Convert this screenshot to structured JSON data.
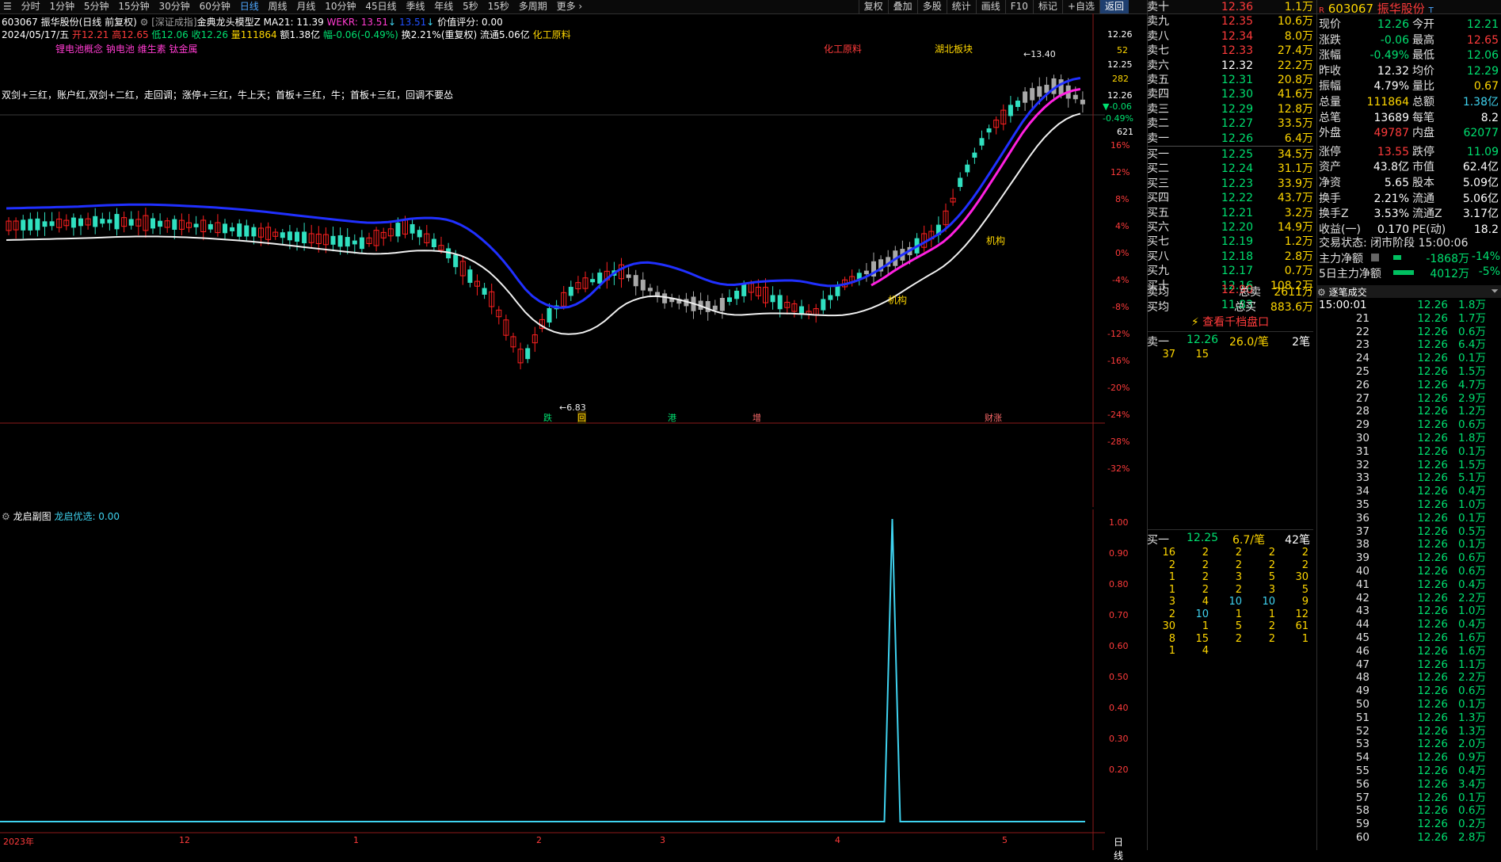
{
  "topbar": {
    "periods": [
      "分时",
      "1分钟",
      "5分钟",
      "15分钟",
      "30分钟",
      "60分钟",
      "日线",
      "周线",
      "月线",
      "10分钟",
      "45日线",
      "季线",
      "年线",
      "5秒",
      "15秒",
      "多周期",
      "更多"
    ],
    "active": "日线",
    "tools": [
      "复权",
      "叠加",
      "多股",
      "统计",
      "画线",
      "F10",
      "标记",
      "+自选",
      "返回"
    ]
  },
  "header": {
    "line1": {
      "code_name": "603067 振华股份(日线 前复权)",
      "index_source": "[深证成指]",
      "model": "金典龙头模型Z",
      "ma": "MA21: 11.39",
      "wekr": "WEKR: 13.51",
      "wekr2": "13.51",
      "value_score": "价值评分: 0.00"
    },
    "line2": {
      "date": "2024/05/17/五",
      "open": "开12.21",
      "high": "高12.65",
      "low": "低12.06",
      "close": "收12.26",
      "volume": "量111864",
      "amount": "额1.38亿",
      "change": "幅-0.06(-0.49%)",
      "turnover": "换2.21%(重复权)",
      "float": "流通5.06亿",
      "industry": "化工原料"
    },
    "concepts": "锂电池概念 钠电池 维生素 钛金属",
    "strategy_note": "双剑+三红，账户红,双剑+二红，走回调；涨停+三红，牛上天；首板+三红，牛；首板+三红，回调不要怂"
  },
  "chart_labels": {
    "sector1": "化工原料",
    "sector2": "湖北板块",
    "high_mark": "13.40",
    "low_mark": "6.83",
    "inst1": "机构",
    "inst2": "机构",
    "events": [
      "跌",
      "回",
      "港",
      "增",
      "财涨"
    ],
    "x_labels": [
      "2023年",
      "12",
      "1",
      "2",
      "3",
      "4",
      "5"
    ],
    "period_tag": "日线"
  },
  "right_axis": {
    "price_top": "12.26",
    "vals": [
      "12.26",
      "52",
      "12.25",
      "282",
      "12.26",
      "▼-0.06",
      "-0.49%",
      "621"
    ],
    "pct": [
      "16%",
      "12%",
      "8%",
      "4%",
      "0%",
      "-4%",
      "-8%",
      "-12%",
      "-16%",
      "-20%",
      "-24%",
      "-28%",
      "-32%"
    ],
    "sub": [
      "1.00",
      "0.90",
      "0.80",
      "0.70",
      "0.60",
      "0.50",
      "0.40",
      "0.30",
      "0.20"
    ]
  },
  "subchart": {
    "title": "龙启副图",
    "indicator": "龙启优选: 0.00"
  },
  "chart_data": {
    "type": "line",
    "title": "龙启优选",
    "x": [
      "2023-11",
      "2023-12",
      "2024-01",
      "2024-02",
      "2024-03",
      "2024-04",
      "2024-05"
    ],
    "series": [
      {
        "name": "龙启优选",
        "signal_index_fraction": 0.815,
        "peak": 1.0,
        "baseline": 0.0
      }
    ],
    "ylim": [
      0,
      1.0
    ]
  },
  "orderbook": {
    "asks": [
      {
        "label": "卖十",
        "price": "12.36",
        "vol": "1.1万"
      },
      {
        "label": "卖九",
        "price": "12.35",
        "vol": "10.6万"
      },
      {
        "label": "卖八",
        "price": "12.34",
        "vol": "8.0万"
      },
      {
        "label": "卖七",
        "price": "12.33",
        "vol": "27.4万"
      },
      {
        "label": "卖六",
        "price": "12.32",
        "vol": "22.2万"
      },
      {
        "label": "卖五",
        "price": "12.31",
        "vol": "20.8万"
      },
      {
        "label": "卖四",
        "price": "12.30",
        "vol": "41.6万"
      },
      {
        "label": "卖三",
        "price": "12.29",
        "vol": "12.8万"
      },
      {
        "label": "卖二",
        "price": "12.27",
        "vol": "33.5万"
      },
      {
        "label": "卖一",
        "price": "12.26",
        "vol": "6.4万"
      }
    ],
    "bids": [
      {
        "label": "买一",
        "price": "12.25",
        "vol": "34.5万"
      },
      {
        "label": "买二",
        "price": "12.24",
        "vol": "31.1万"
      },
      {
        "label": "买三",
        "price": "12.23",
        "vol": "33.9万"
      },
      {
        "label": "买四",
        "price": "12.22",
        "vol": "43.7万"
      },
      {
        "label": "买五",
        "price": "12.21",
        "vol": "3.2万"
      },
      {
        "label": "买六",
        "price": "12.20",
        "vol": "14.9万"
      },
      {
        "label": "买七",
        "price": "12.19",
        "vol": "1.2万"
      },
      {
        "label": "买八",
        "price": "12.18",
        "vol": "2.8万"
      },
      {
        "label": "买九",
        "price": "12.17",
        "vol": "0.7万"
      },
      {
        "label": "买十",
        "price": "12.16",
        "vol": "108.2万"
      }
    ],
    "sell_avg": {
      "label": "卖均",
      "price": "12.90",
      "k": "总卖",
      "v": "2611万"
    },
    "buy_avg": {
      "label": "买均",
      "price": "11.83",
      "k": "总买",
      "v": "883.6万"
    },
    "link": "查看千档盘口",
    "sell1_queue": {
      "label": "卖一",
      "price": "12.26",
      "per": "26.0/笔",
      "count": "2笔",
      "items": [
        "37",
        "15"
      ]
    },
    "buy1_queue": {
      "label": "买一",
      "price": "12.25",
      "per": "6.7/笔",
      "count": "42笔",
      "items": [
        "16",
        "2",
        "2",
        "2",
        "2",
        "2",
        "2",
        "2",
        "2",
        "2",
        "1",
        "2",
        "3",
        "5",
        "30",
        "1",
        "2",
        "2",
        "3",
        "5",
        "3",
        "4",
        "10",
        "10",
        "9",
        "2",
        "10",
        "1",
        "1",
        "12",
        "30",
        "1",
        "5",
        "2",
        "61",
        "8",
        "15",
        "2",
        "2",
        "1",
        "1",
        "4"
      ]
    }
  },
  "quote": {
    "code": "603067",
    "name": "振华股份",
    "rows": [
      {
        "k1": "现价",
        "v1": "12.26",
        "k2": "今开",
        "v2": "12.21"
      },
      {
        "k1": "涨跌",
        "v1": "-0.06",
        "k2": "最高",
        "v2": "12.65"
      },
      {
        "k1": "涨幅",
        "v1": "-0.49%",
        "k2": "最低",
        "v2": "12.06"
      },
      {
        "k1": "昨收",
        "v1": "12.32",
        "k2": "均价",
        "v2": "12.29"
      },
      {
        "k1": "振幅",
        "v1": "4.79%",
        "k2": "量比",
        "v2": "0.67"
      },
      {
        "k1": "总量",
        "v1": "111864",
        "k2": "总额",
        "v2": "1.38亿"
      },
      {
        "k1": "总笔",
        "v1": "13689",
        "k2": "每笔",
        "v2": "8.2"
      },
      {
        "k1": "外盘",
        "v1": "49787",
        "k2": "内盘",
        "v2": "62077"
      },
      {
        "k1": "涨停",
        "v1": "13.55",
        "k2": "跌停",
        "v2": "11.09"
      },
      {
        "k1": "资产",
        "v1": "43.8亿",
        "k2": "市值",
        "v2": "62.4亿"
      },
      {
        "k1": "净资",
        "v1": "5.65",
        "k2": "股本",
        "v2": "5.09亿"
      },
      {
        "k1": "换手",
        "v1": "2.21%",
        "k2": "流通",
        "v2": "5.06亿"
      },
      {
        "k1": "换手Z",
        "v1": "3.53%",
        "k2": "流通Z",
        "v2": "3.17亿"
      },
      {
        "k1": "收益(一)",
        "v1": "0.170",
        "k2": "PE(动)",
        "v2": "18.2"
      }
    ],
    "trade_status": "交易状态: 闭市阶段 15:00:06",
    "main_net": {
      "k": "主力净额",
      "v": "-1868万",
      "p": "-14%"
    },
    "main_net5": {
      "k": "5日主力净额",
      "v": "4012万",
      "p": "-5%"
    }
  },
  "ticks": {
    "title": "逐笔成交",
    "first_time": "15:00:01",
    "rows": [
      {
        "t": "",
        "p": "12.26",
        "v": "1.8万"
      },
      {
        "t": "21",
        "p": "12.26",
        "v": "1.7万"
      },
      {
        "t": "22",
        "p": "12.26",
        "v": "0.6万"
      },
      {
        "t": "23",
        "p": "12.26",
        "v": "6.4万"
      },
      {
        "t": "24",
        "p": "12.26",
        "v": "0.1万"
      },
      {
        "t": "25",
        "p": "12.26",
        "v": "1.5万"
      },
      {
        "t": "26",
        "p": "12.26",
        "v": "4.7万"
      },
      {
        "t": "27",
        "p": "12.26",
        "v": "2.9万"
      },
      {
        "t": "28",
        "p": "12.26",
        "v": "1.2万"
      },
      {
        "t": "29",
        "p": "12.26",
        "v": "0.6万"
      },
      {
        "t": "30",
        "p": "12.26",
        "v": "1.8万"
      },
      {
        "t": "31",
        "p": "12.26",
        "v": "0.1万"
      },
      {
        "t": "32",
        "p": "12.26",
        "v": "1.5万"
      },
      {
        "t": "33",
        "p": "12.26",
        "v": "5.1万"
      },
      {
        "t": "34",
        "p": "12.26",
        "v": "0.4万"
      },
      {
        "t": "35",
        "p": "12.26",
        "v": "1.0万"
      },
      {
        "t": "36",
        "p": "12.26",
        "v": "0.1万"
      },
      {
        "t": "37",
        "p": "12.26",
        "v": "0.5万"
      },
      {
        "t": "38",
        "p": "12.26",
        "v": "0.1万"
      },
      {
        "t": "39",
        "p": "12.26",
        "v": "0.6万"
      },
      {
        "t": "40",
        "p": "12.26",
        "v": "0.6万"
      },
      {
        "t": "41",
        "p": "12.26",
        "v": "0.4万"
      },
      {
        "t": "42",
        "p": "12.26",
        "v": "2.2万"
      },
      {
        "t": "43",
        "p": "12.26",
        "v": "1.0万"
      },
      {
        "t": "44",
        "p": "12.26",
        "v": "0.4万"
      },
      {
        "t": "45",
        "p": "12.26",
        "v": "1.6万"
      },
      {
        "t": "46",
        "p": "12.26",
        "v": "1.6万"
      },
      {
        "t": "47",
        "p": "12.26",
        "v": "1.1万"
      },
      {
        "t": "48",
        "p": "12.26",
        "v": "2.2万"
      },
      {
        "t": "49",
        "p": "12.26",
        "v": "0.6万"
      },
      {
        "t": "50",
        "p": "12.26",
        "v": "0.1万"
      },
      {
        "t": "51",
        "p": "12.26",
        "v": "1.3万"
      },
      {
        "t": "52",
        "p": "12.26",
        "v": "1.3万"
      },
      {
        "t": "53",
        "p": "12.26",
        "v": "2.0万"
      },
      {
        "t": "54",
        "p": "12.26",
        "v": "0.9万"
      },
      {
        "t": "55",
        "p": "12.26",
        "v": "0.4万"
      },
      {
        "t": "56",
        "p": "12.26",
        "v": "3.4万"
      },
      {
        "t": "57",
        "p": "12.26",
        "v": "0.1万"
      },
      {
        "t": "58",
        "p": "12.26",
        "v": "0.6万"
      },
      {
        "t": "59",
        "p": "12.26",
        "v": "0.2万"
      },
      {
        "t": "60",
        "p": "12.26",
        "v": "2.8万"
      }
    ]
  }
}
